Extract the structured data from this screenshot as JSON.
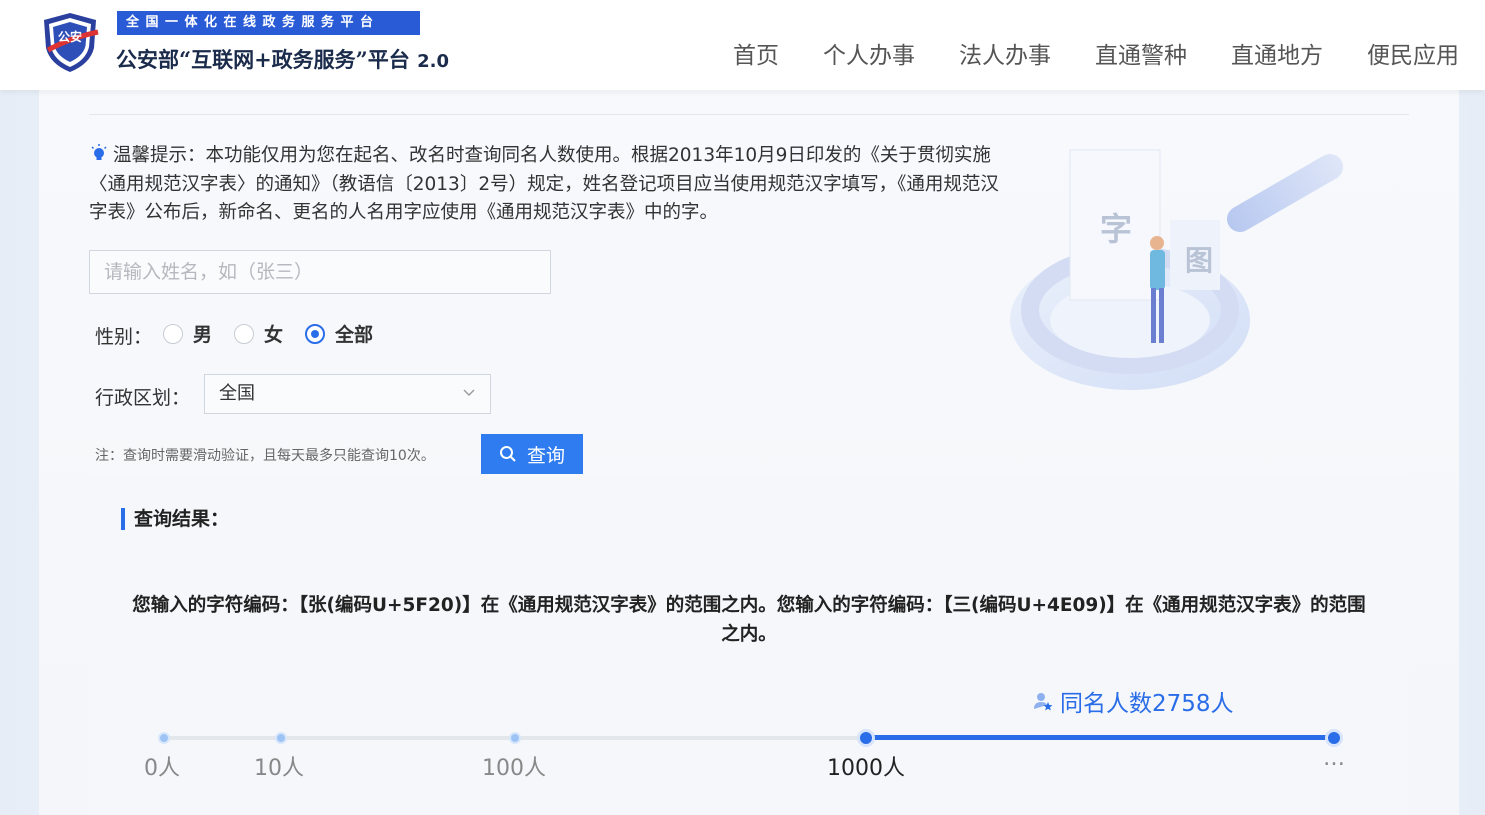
{
  "header": {
    "logo_text": "公安",
    "slogan": "全国一体化在线政务服务平台",
    "title": "公安部“互联网+政务服务”平台",
    "version": "2.0",
    "nav": [
      "首页",
      "个人办事",
      "法人办事",
      "直通警种",
      "直通地方",
      "便民应用"
    ]
  },
  "hint": {
    "text": "温馨提示：本功能仅用为您在起名、改名时查询同名人数使用。根据2013年10月9日印发的《关于贯彻实施〈通用规范汉字表〉的通知》（教语信〔2013〕2号）规定，姓名登记项目应当使用规范汉字填写，《通用规范汉字表》公布后，新命名、更名的人名用字应使用《通用规范汉字表》中的字。"
  },
  "form": {
    "name_placeholder": "请输入姓名，如（张三）",
    "name_value": "",
    "gender_label": "性别：",
    "gender_options": [
      "男",
      "女",
      "全部"
    ],
    "gender_selected": "全部",
    "region_label": "行政区划：",
    "region_value": "全国",
    "note": "注：查询时需要滑动验证，且每天最多只能查询10次。",
    "query_button": "查询"
  },
  "result": {
    "title": "查询结果：",
    "text": "您输入的字符编码：【张(编码U+5F20)】在《通用规范汉字表》的范围之内。您输入的字符编码：【三(编码U+4E09)】在《通用规范汉字表》的范围之内。",
    "count_label": "同名人数2758人",
    "count": 2758,
    "ticks": [
      "0人",
      "10人",
      "100人",
      "1000人",
      "…"
    ],
    "active_tick": "1000人"
  },
  "colors": {
    "brand_blue": "#2a5bd7",
    "accent_blue": "#2a6de8",
    "button_blue": "#2e7cf0"
  }
}
